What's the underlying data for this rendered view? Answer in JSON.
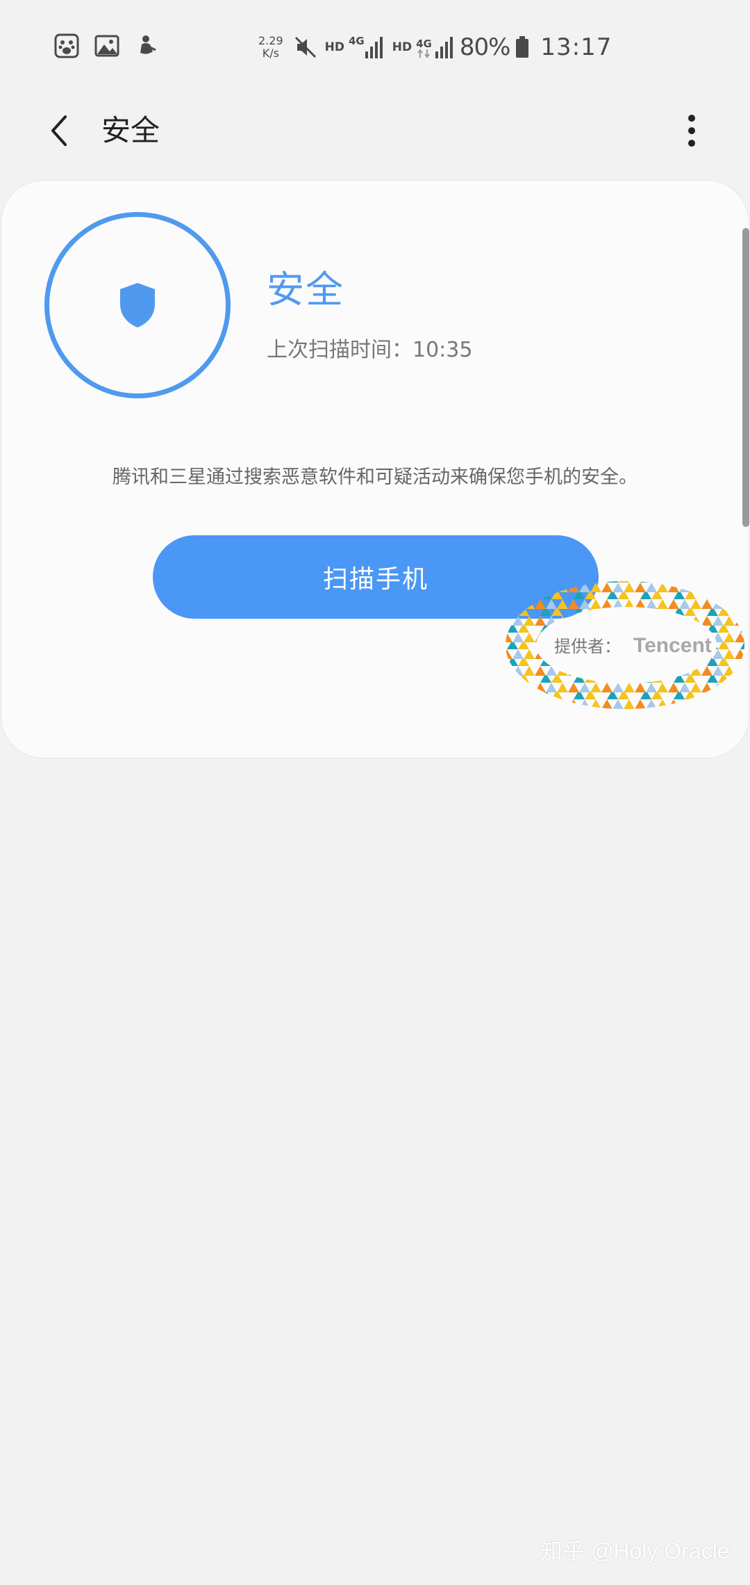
{
  "status_bar": {
    "net_speed_value": "2.29",
    "net_speed_unit": "K/s",
    "hd_label_1": "HD",
    "net_type_1": "4G",
    "hd_label_2": "HD",
    "net_type_2": "4G",
    "battery": "80%",
    "time": "13:17",
    "icons": [
      "baidu-app-icon",
      "gallery-icon",
      "notification-app-icon",
      "mute-icon",
      "signal-icon",
      "signal-icon",
      "battery-icon"
    ]
  },
  "app_bar": {
    "title": "安全"
  },
  "security_card": {
    "status_title": "安全",
    "last_scan": "上次扫描时间：10:35",
    "description": "腾讯和三星通过搜索恶意软件和可疑活动来确保您手机的安全。",
    "scan_button_label": "扫描手机",
    "provider_label": "提供者：",
    "provider_name": "Tencent"
  },
  "watermark": "知乎 @Holy Oracle",
  "colors": {
    "accent": "#4f9aee",
    "button": "#4a97f5",
    "background": "#f2f2f2",
    "card": "#fbfbfb"
  }
}
